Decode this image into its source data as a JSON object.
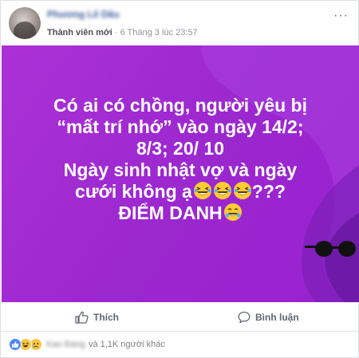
{
  "post": {
    "author": "Phương Lê Dâu",
    "badge": "Thành viên mới",
    "separator": " · ",
    "time": "6 Tháng 3 lúc 23:57",
    "more_label": "···",
    "text_lines": [
      "Có ai có chồng, người yêu bị",
      "“mất trí nhớ” vào ngày 14/2;",
      "8/3; 20/ 10",
      "Ngày sinh nhật vợ và ngày",
      "cưới không ạ",
      "???",
      "ĐIỂM DANH"
    ],
    "background_color": "#9b27cf"
  },
  "actions": {
    "like_label": "Thích",
    "comment_label": "Bình luận"
  },
  "reactions": {
    "types": [
      "like-icon",
      "haha-icon",
      "sad-icon"
    ],
    "first_name": "Kao Đang",
    "others_text": "và 1,1K người khác"
  },
  "colors": {
    "link": "#365899",
    "meta": "#90949c",
    "action": "#606770",
    "like_blue": "#4e88f7"
  }
}
